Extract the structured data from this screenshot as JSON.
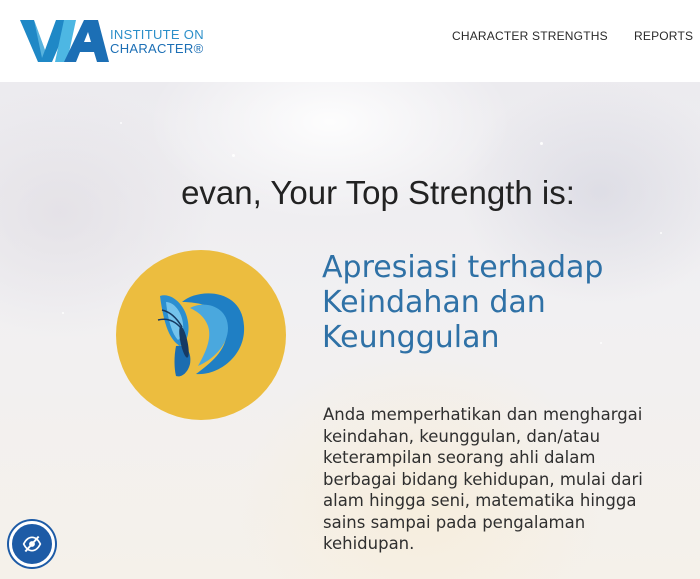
{
  "header": {
    "logo": {
      "mark": "VIA",
      "line1": "INSTITUTE ON",
      "line2": "CHARACTER®"
    },
    "nav": [
      {
        "label": "CHARACTER STRENGTHS"
      },
      {
        "label": "REPORTS"
      }
    ]
  },
  "hero": {
    "title": "evan, Your Top Strength is:",
    "strength": {
      "name": "Apresiasi terhadap Keindahan dan Keunggulan",
      "icon": "butterfly-icon",
      "description": "Anda memperhatikan dan menghargai keindahan, keunggulan, dan/atau keterampilan seorang ahli dalam berbagai bidang kehidupan, mulai dari alam hingga seni, matematika hingga sains sampai pada pengalaman kehidupan."
    }
  },
  "accessibility_button": {
    "icon": "eye-slash-icon"
  },
  "colors": {
    "brand_blue": "#2b8fc9",
    "badge_gold": "#ecbd3f",
    "strength_title": "#2f71a6",
    "a11y_blue": "#1d5ba6"
  }
}
